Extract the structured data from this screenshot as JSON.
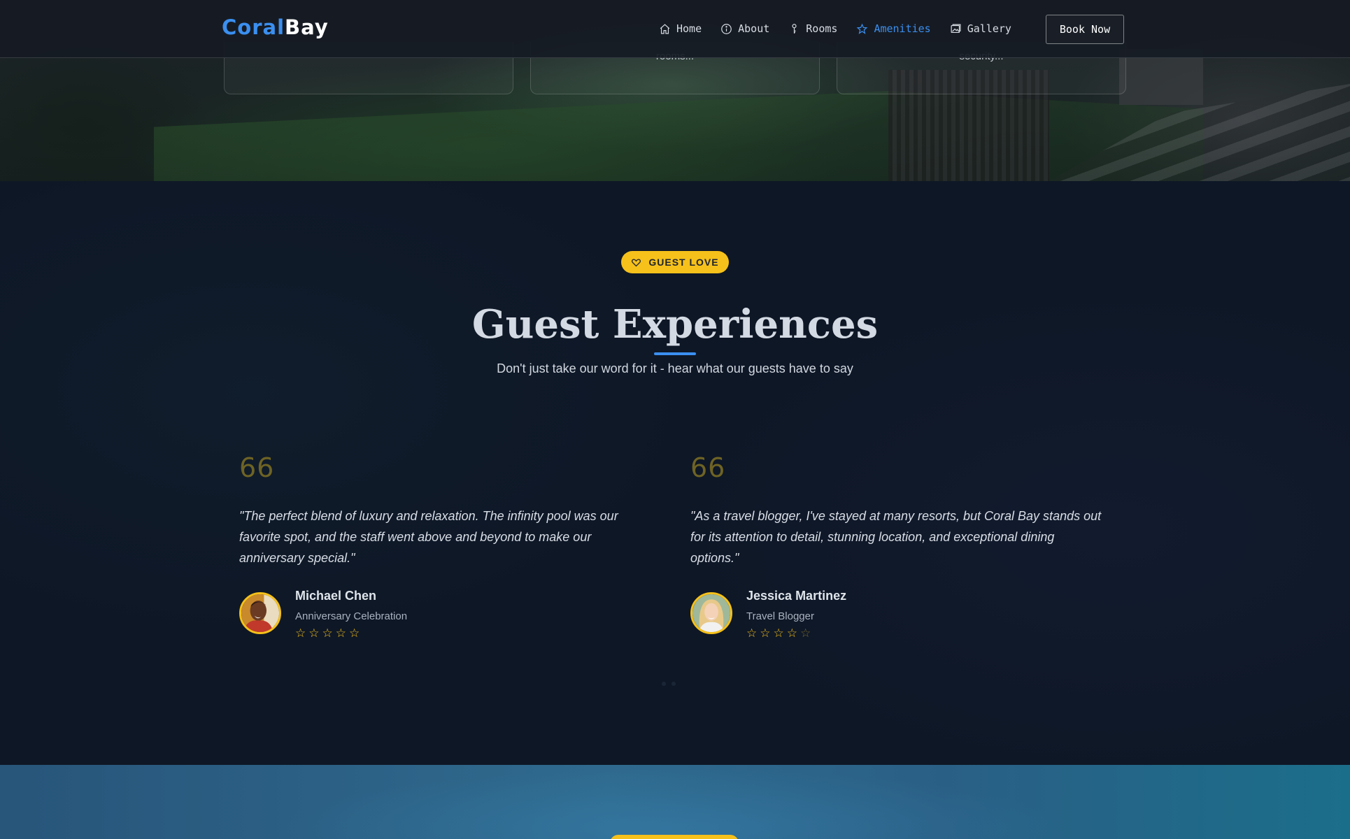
{
  "brand": {
    "part1": "Coral",
    "part2": "Bay",
    "accent": "#3b8ff0"
  },
  "nav": {
    "items": [
      {
        "label": "Home",
        "icon": "home-icon"
      },
      {
        "label": "About",
        "icon": "info-icon"
      },
      {
        "label": "Rooms",
        "icon": "key-icon"
      },
      {
        "label": "Amenities",
        "icon": "star-icon",
        "active": true
      },
      {
        "label": "Gallery",
        "icon": "image-icon"
      }
    ],
    "cta": "Book Now"
  },
  "hero_cards": [
    {
      "text": ""
    },
    {
      "text": "rooms..."
    },
    {
      "text": "security..."
    }
  ],
  "testimonials": {
    "badge": "GUEST LOVE",
    "badge_icon": "heart-icon",
    "title": "Guest Experiences",
    "subtitle": "Don't just take our word for it - hear what our guests have to say",
    "quote_mark": "66",
    "reviews": [
      {
        "text": "\"The perfect blend of luxury and relaxation. The infinity pool was our favorite spot, and the staff went above and beyond to make our anniversary special.\"",
        "name": "Michael Chen",
        "role": "Anniversary Celebration",
        "rating": 5
      },
      {
        "text": "\"As a travel blogger, I've stayed at many resorts, but Coral Bay stands out for its attention to detail, stunning location, and exceptional dining options.\"",
        "name": "Jessica Martinez",
        "role": "Travel Blogger",
        "rating": 4
      }
    ]
  },
  "colors": {
    "badge": "#f6c11a",
    "background": "#0e1726",
    "active_nav": "#3b8ff0"
  }
}
